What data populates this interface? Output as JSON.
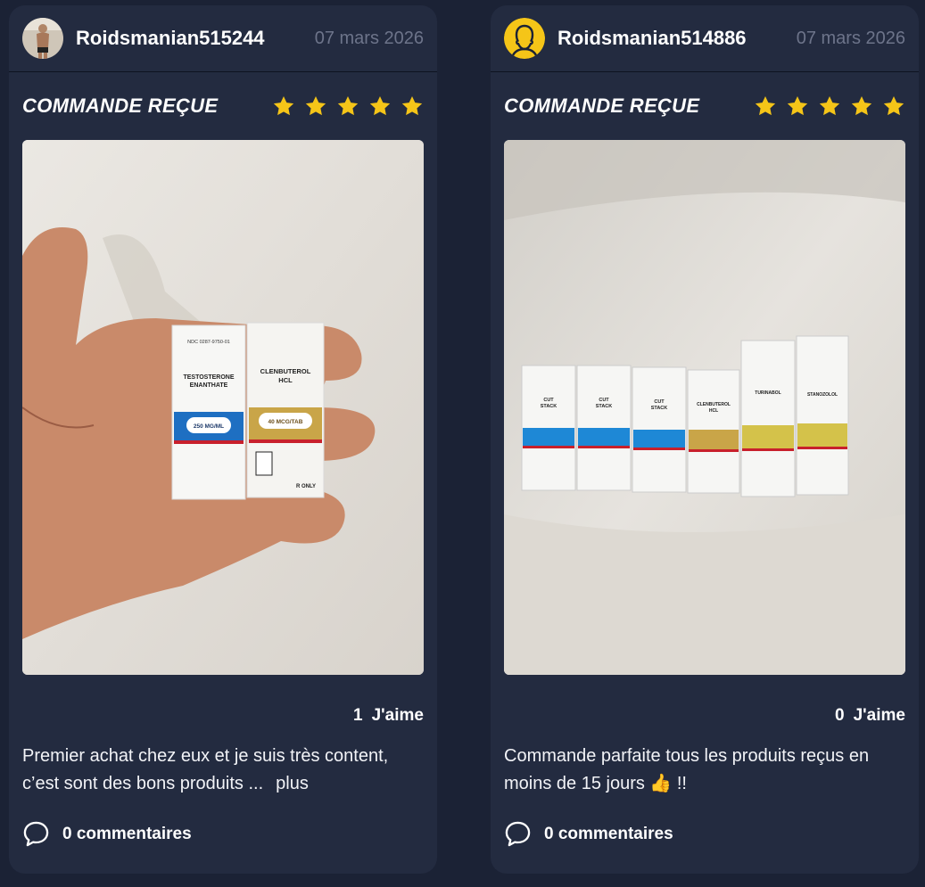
{
  "posts": [
    {
      "username": "Roidsmanian515244",
      "date": "07 mars 2026",
      "status": "COMMANDE REÇUE",
      "rating": 5,
      "likes_count": "1",
      "likes_label": "J'aime",
      "text": "Premier achat chez eux et je suis très content, c’est sont des bons produits ...",
      "more_label": "plus",
      "comments_label": "0 commentaires",
      "photo_labels": [
        "TESTOSTERONE ENANTHATE",
        "250 MG/ML",
        "CLENBUTEROL HCL",
        "40 MCG/TAB"
      ]
    },
    {
      "username": "Roidsmanian514886",
      "date": "07 mars 2026",
      "status": "COMMANDE REÇUE",
      "rating": 5,
      "likes_count": "0",
      "likes_label": "J'aime",
      "text": "Commande parfaite tous les produits reçus en moins de 15 jours 👍 !!",
      "more_label": "",
      "comments_label": "0 commentaires",
      "photo_labels": [
        "CUT STACK",
        "CUT STACK",
        "CUT STACK",
        "CLENBUTEROL HCL",
        "TURINABOL",
        "STANOZOLOL"
      ]
    }
  ],
  "colors": {
    "background": "#1b2235",
    "card": "#232b40",
    "star": "#f5c518",
    "muted": "#6d748a"
  },
  "icons": [
    "star-icon",
    "comment-bubble-icon",
    "user-avatar-icon"
  ]
}
